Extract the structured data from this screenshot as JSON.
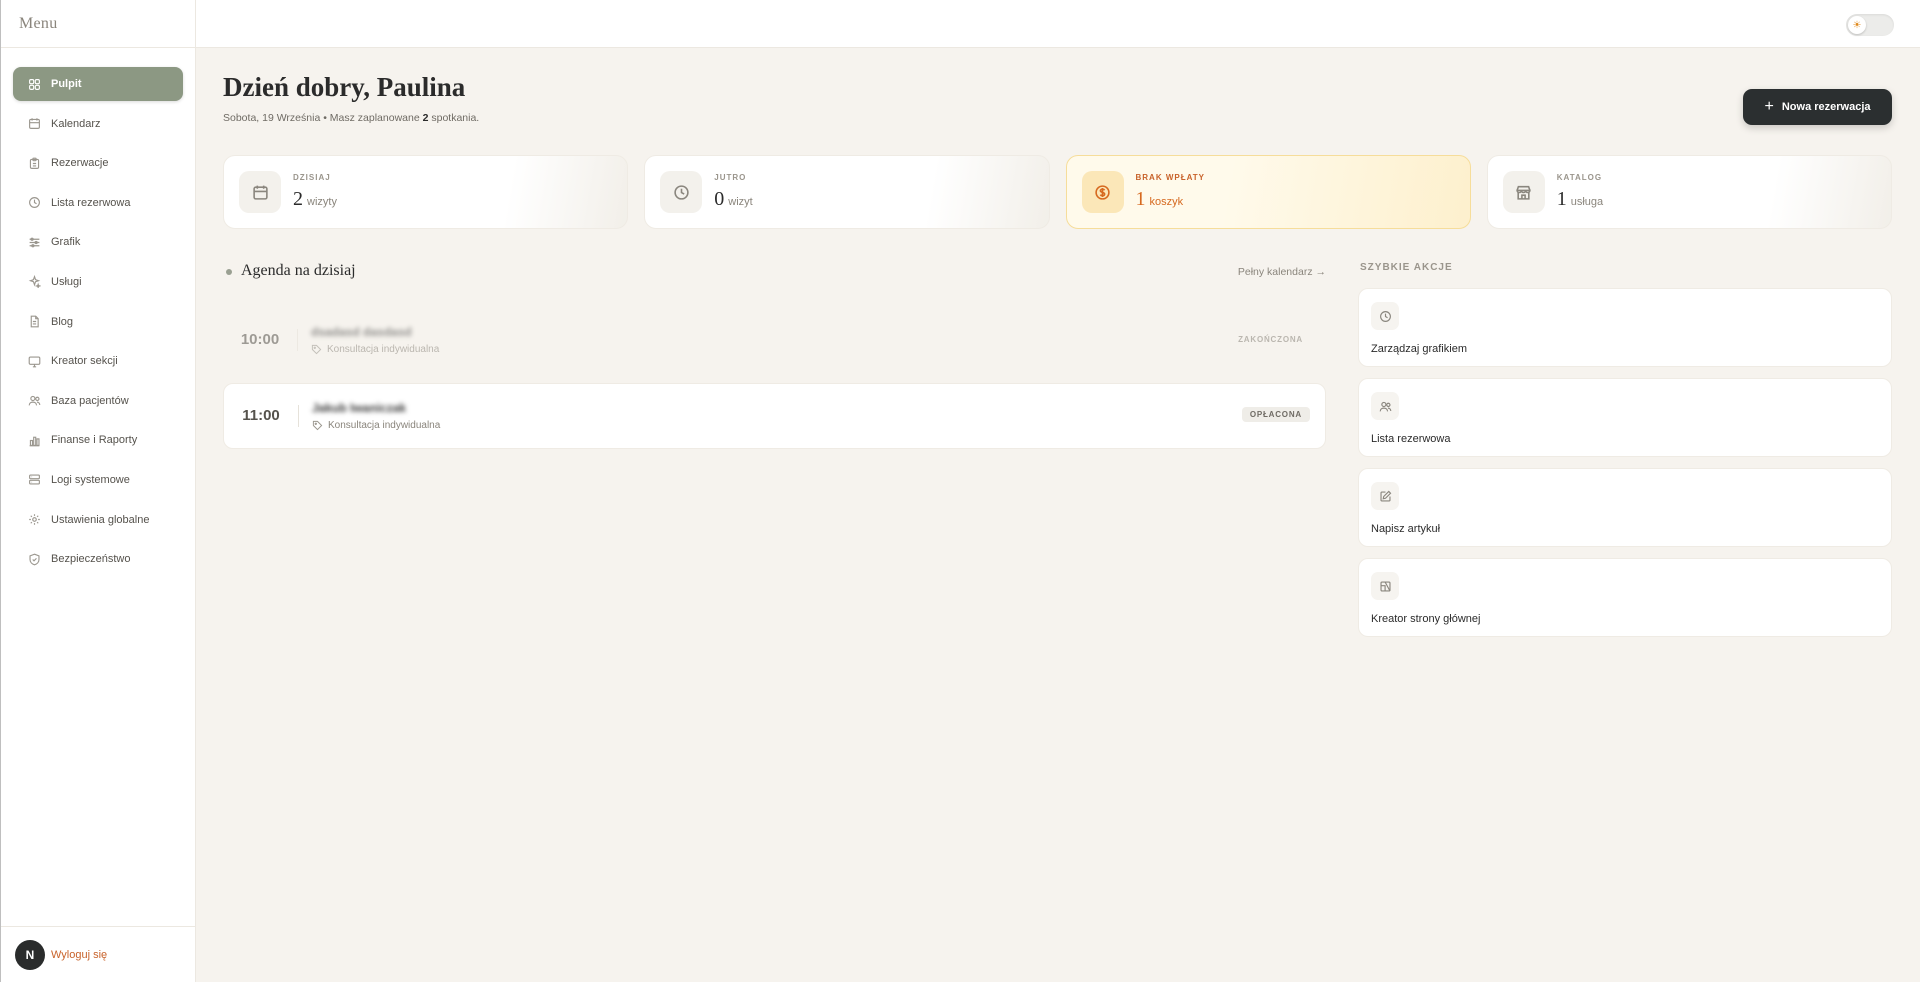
{
  "sidebar": {
    "title": "Menu",
    "items": [
      {
        "label": "Pulpit",
        "icon": "dashboard-icon",
        "active": true
      },
      {
        "label": "Kalendarz",
        "icon": "calendar-icon"
      },
      {
        "label": "Rezerwacje",
        "icon": "clipboard-icon"
      },
      {
        "label": "Lista rezerwowa",
        "icon": "clock-icon"
      },
      {
        "label": "Grafik",
        "icon": "sliders-icon"
      },
      {
        "label": "Usługi",
        "icon": "sparkles-icon"
      },
      {
        "label": "Blog",
        "icon": "document-icon"
      },
      {
        "label": "Kreator sekcji",
        "icon": "monitor-icon"
      },
      {
        "label": "Baza pacjentów",
        "icon": "users-icon"
      },
      {
        "label": "Finanse i Raporty",
        "icon": "bar-chart-icon"
      },
      {
        "label": "Logi systemowe",
        "icon": "server-icon"
      },
      {
        "label": "Ustawienia globalne",
        "icon": "gear-icon"
      },
      {
        "label": "Bezpieczeństwo",
        "icon": "shield-icon"
      }
    ],
    "avatar_letter": "N",
    "logout_label": "Wyloguj się"
  },
  "topbar": {
    "theme_toggle_icon": "sun-icon"
  },
  "header": {
    "greeting": "Dzień dobry, Paulina",
    "date_text": "Sobota, 19 Września • Masz zaplanowane ",
    "count": "2",
    "suffix": " spotkania.",
    "new_button": "Nowa rezerwacja"
  },
  "stats": [
    {
      "label": "DZISIAJ",
      "value": "2",
      "unit": "wizyty",
      "icon": "calendar-icon"
    },
    {
      "label": "JUTRO",
      "value": "0",
      "unit": "wizyt",
      "icon": "clock-icon"
    },
    {
      "label": "BRAK WPŁATY",
      "value": "1",
      "unit": "koszyk",
      "icon": "dollar-icon"
    },
    {
      "label": "KATALOG",
      "value": "1",
      "unit": "usługa",
      "icon": "store-icon"
    }
  ],
  "agenda": {
    "title": "Agenda na dzisiaj",
    "full_calendar": "Pełny kalendarz →",
    "items": [
      {
        "time": "10:00",
        "name": "dsadasd dasdasd",
        "service": "Konsultacja indywidualna",
        "status": "ZAKOŃCZONA"
      },
      {
        "time": "11:00",
        "name": "Jakub Iwaniczak",
        "service": "Konsultacja indywidualna",
        "status": "OPŁACONA"
      }
    ]
  },
  "quick_actions": {
    "title": "SZYBKIE AKCJE",
    "items": [
      {
        "label": "Zarządzaj grafikiem",
        "icon": "clock-icon"
      },
      {
        "label": "Lista rezerwowa",
        "icon": "users-icon"
      },
      {
        "label": "Napisz artykuł",
        "icon": "edit-icon"
      },
      {
        "label": "Kreator strony głównej",
        "icon": "layout-icon"
      }
    ]
  }
}
